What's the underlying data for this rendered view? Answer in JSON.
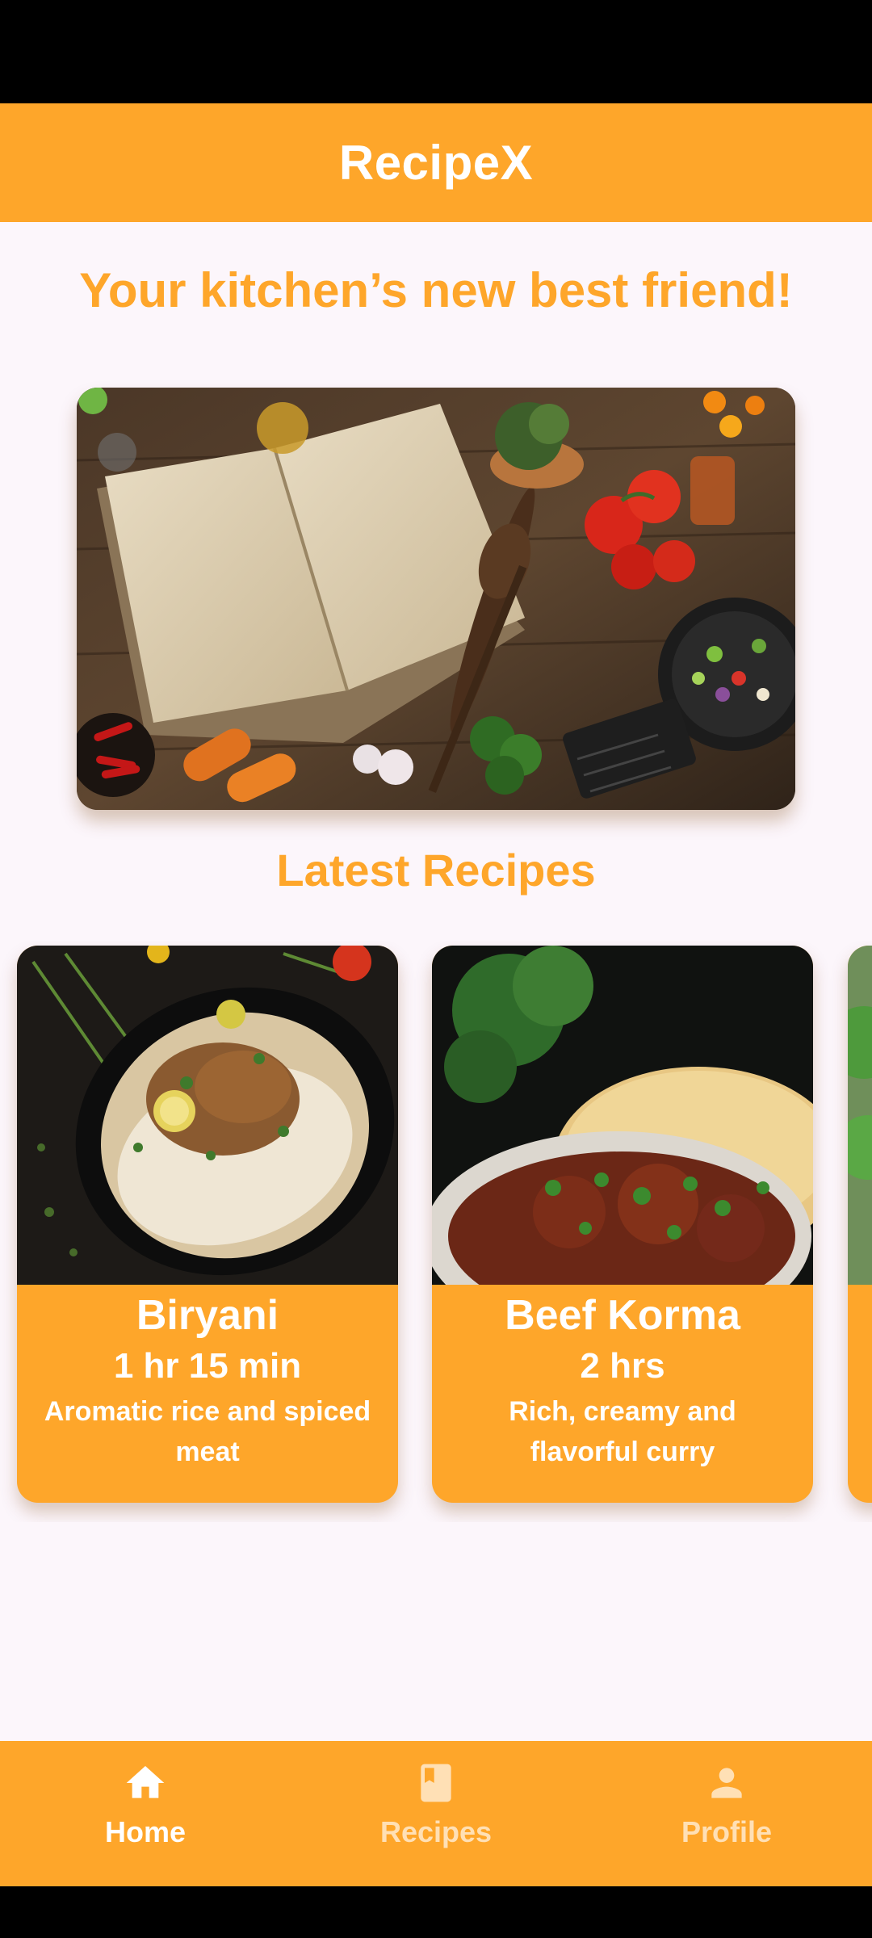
{
  "app": {
    "title": "RecipeX"
  },
  "home": {
    "tagline": "Your kitchen’s new best friend!",
    "latest_title": "Latest Recipes"
  },
  "recipes": [
    {
      "name": "Biryani",
      "time": "1 hr 15 min",
      "description": "Aromatic rice and spiced meat"
    },
    {
      "name": "Beef Korma",
      "time": "2 hrs",
      "description": "Rich, creamy and flavorful curry"
    }
  ],
  "bottom_nav": {
    "items": [
      {
        "label": "Home",
        "icon": "home-icon",
        "active": true
      },
      {
        "label": "Recipes",
        "icon": "book-icon",
        "active": false
      },
      {
        "label": "Profile",
        "icon": "person-icon",
        "active": false
      }
    ]
  },
  "colors": {
    "accent": "#fea62a",
    "background": "#fcf6fb",
    "inactive_nav": "#ffe0b5"
  }
}
